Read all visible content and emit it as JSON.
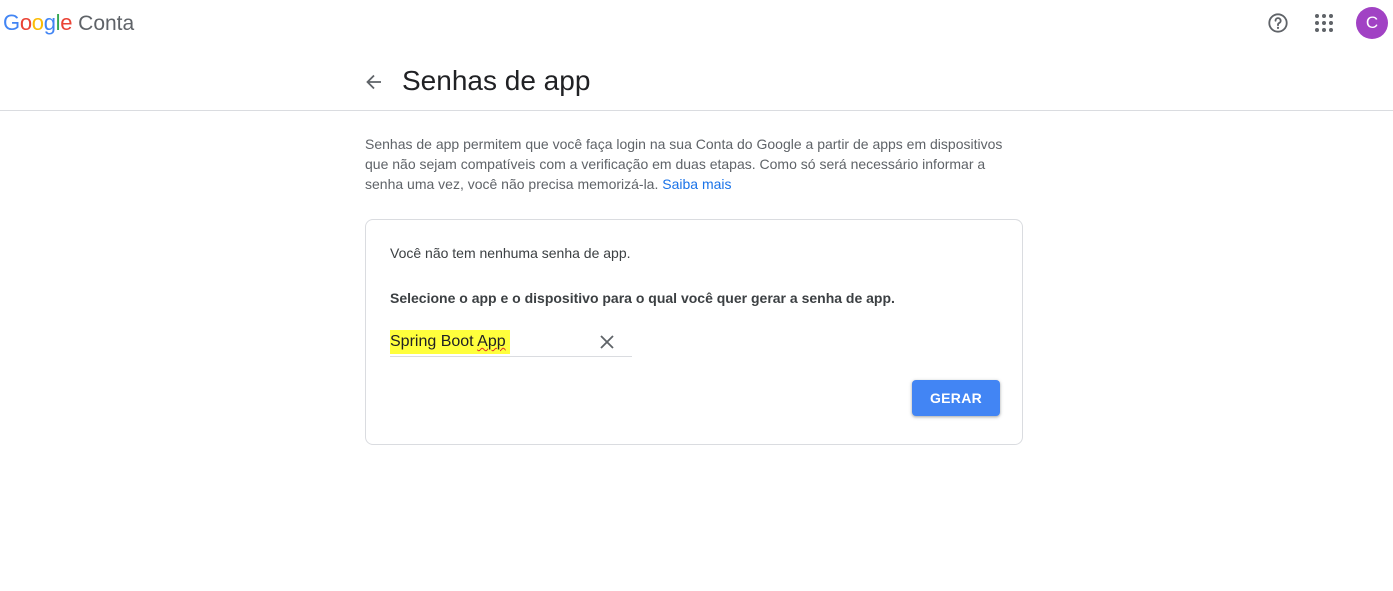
{
  "header": {
    "logo_letters": [
      {
        "ch": "G",
        "color": "#4285F4"
      },
      {
        "ch": "o",
        "color": "#EA4335"
      },
      {
        "ch": "o",
        "color": "#FBBC05"
      },
      {
        "ch": "g",
        "color": "#4285F4"
      },
      {
        "ch": "l",
        "color": "#34A853"
      },
      {
        "ch": "e",
        "color": "#EA4335"
      }
    ],
    "product": "Conta",
    "help_icon": "help-circle-icon",
    "apps_icon": "apps-grid-icon",
    "avatar_letter": "C",
    "avatar_color": "#a142c4"
  },
  "page": {
    "back_icon": "arrow-back-icon",
    "title": "Senhas de app",
    "intro_text": "Senhas de app permitem que você faça login na sua Conta do Google a partir de apps em dispositivos que não sejam compatíveis com a verificação em duas etapas. Como só será necessário informar a senha uma vez, você não precisa memorizá-la.",
    "learn_more": "Saiba mais"
  },
  "card": {
    "no_passwords": "Você não tem nenhuma senha de app.",
    "select_prompt": "Selecione o app e o dispositivo para o qual você quer gerar a senha de app.",
    "app_name_part1": "Spring Boot ",
    "app_name_part2": "App",
    "clear_icon": "close-icon",
    "generate_label": "GERAR",
    "generate_color": "#4285f4"
  }
}
